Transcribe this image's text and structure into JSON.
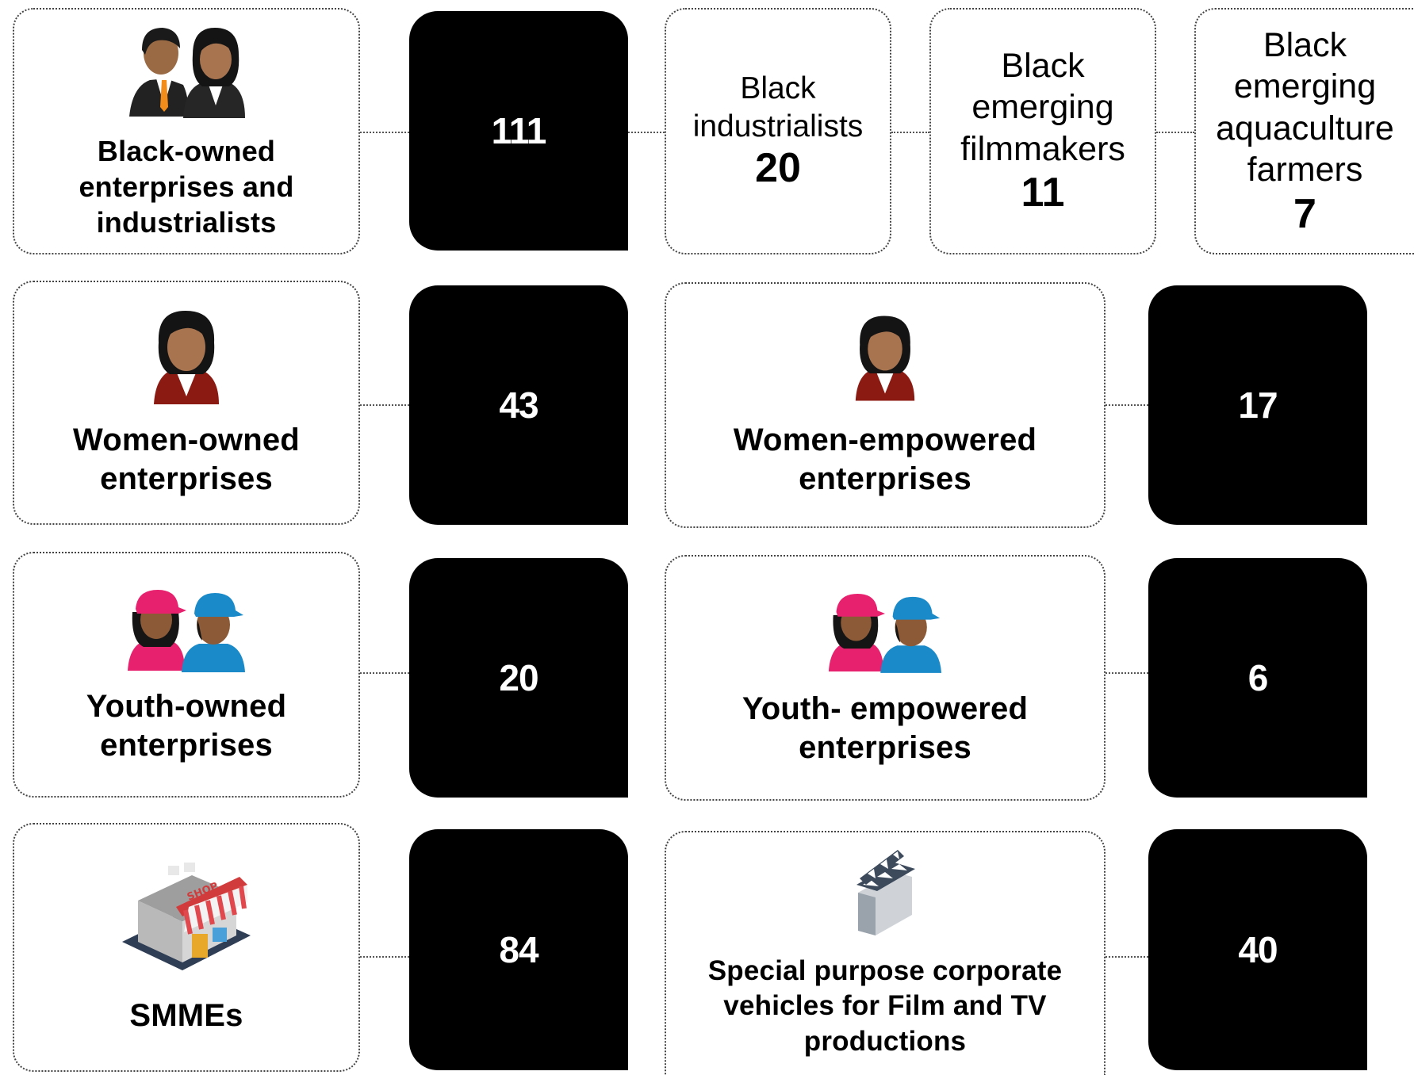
{
  "rows": [
    {
      "label": "Black-owned enterprises and industrialists",
      "icon": "black-business-people-icon",
      "count": "111",
      "sub_items": [
        {
          "label": "Black industrialists",
          "count": "20"
        },
        {
          "label": "Black emerging filmmakers",
          "count": "11"
        },
        {
          "label": "Black emerging aquaculture farmers",
          "count": "7"
        }
      ]
    },
    {
      "label": "Women-owned enterprises",
      "icon": "woman-person-icon",
      "count": "43",
      "right": {
        "label": "Women-empowered enterprises",
        "icon": "woman-person-icon",
        "count": "17"
      }
    },
    {
      "label": "Youth-owned enterprises",
      "icon": "youth-people-icon",
      "count": "20",
      "right": {
        "label": "Youth- empowered enterprises",
        "icon": "youth-people-icon",
        "count": "6"
      }
    },
    {
      "label": "SMMEs",
      "icon": "shop-icon",
      "shop_sign": "SHOP",
      "count": "84",
      "right": {
        "label": "Special purpose corporate vehicles for Film and TV productions",
        "icon": "film-clapperboard-icon",
        "count": "40"
      }
    }
  ],
  "colors": {
    "badge": "#000000",
    "border": "#444444",
    "youth_pink": "#e8216e",
    "youth_blue": "#1b8ac9",
    "maroon": "#8b1a12"
  }
}
